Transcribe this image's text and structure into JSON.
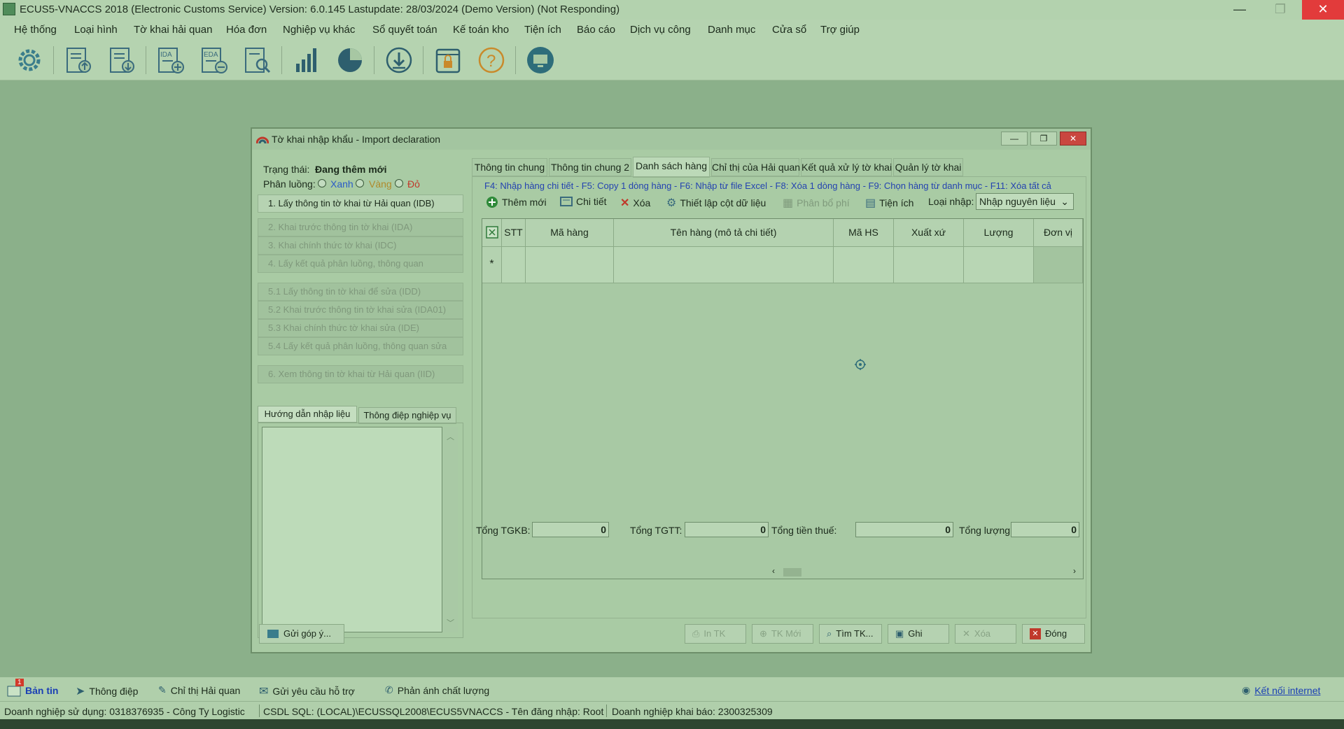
{
  "window": {
    "title": "ECUS5-VNACCS 2018 (Electronic Customs Service) Version: 6.0.145 Lastupdate: 28/03/2024 (Demo Version) (Not Responding)",
    "minimize": "—",
    "maximize": "❐",
    "close": "✕"
  },
  "menu": [
    "Hệ thống",
    "Loại hình",
    "Tờ khai hải quan",
    "Hóa đơn",
    "Nghiệp vụ khác",
    "Sổ quyết toán",
    "Kế toán kho",
    "Tiện ích",
    "Báo cáo",
    "Dịch vụ công",
    "Danh mục",
    "Cửa sổ",
    "Trợ giúp"
  ],
  "toolbar_icons": [
    "settings-gear-icon",
    "export-declaration-icon",
    "import-declaration-icon",
    "ida-add-icon",
    "eda-edit-icon",
    "search-document-icon",
    "bar-chart-icon",
    "pie-chart-icon",
    "download-icon",
    "lock-icon",
    "help-icon",
    "remote-support-icon"
  ],
  "toolbar_labels": {
    "ida": "IDA",
    "eda": "EDA",
    "help": "?"
  },
  "dialog": {
    "title": "Tờ khai nhập khẩu - Import declaration",
    "status_label": "Trạng thái:",
    "status_value": "Đang thêm mới",
    "channel_label": "Phân luồng:",
    "channels": [
      "Xanh",
      "Vàng",
      "Đỏ"
    ],
    "channel_colors": [
      "#2a5bc8",
      "#b08a2a",
      "#c0392b"
    ],
    "steps": [
      "1. Lấy thông tin tờ khai từ Hải quan (IDB)",
      "2. Khai trước thông tin tờ khai (IDA)",
      "3. Khai chính thức tờ khai (IDC)",
      "4. Lấy kết quả phân luồng, thông quan",
      "5.1 Lấy thông tin tờ khai để sửa (IDD)",
      "5.2 Khai trước thông tin tờ khai sửa (IDA01)",
      "5.3 Khai chính thức tờ khai sửa (IDE)",
      "5.4 Lấy kết quả phân luồng, thông quan sửa",
      "6. Xem thông tin tờ khai từ Hải quan (IID)"
    ],
    "subtabs": [
      "Hướng dẫn nhập liệu",
      "Thông điệp nghiệp vụ"
    ],
    "feedback_button": "Gửi góp ý...",
    "tabs": [
      "Thông tin chung",
      "Thông tin chung 2",
      "Danh sách hàng",
      "Chỉ thị của Hải quan",
      "Kết quả xử lý tờ khai",
      "Quản lý tờ khai"
    ],
    "hotkeys": "F4: Nhập hàng chi tiết - F5: Copy 1 dòng hàng - F6: Nhập từ file Excel - F8: Xóa 1 dòng hàng - F9: Chọn hàng từ danh mục - F11: Xóa tất cả",
    "actions": {
      "add": "Thêm mới",
      "detail": "Chi tiết",
      "delete": "Xóa",
      "columns": "Thiết lập cột dữ liệu",
      "allocate": "Phân bổ phí",
      "utility": "Tiện ích",
      "import_type_label": "Loại nhập:",
      "import_type_value": "Nhập nguyên liệu"
    },
    "grid": {
      "columns": [
        "STT",
        "Mã hàng",
        "Tên hàng (mô tả chi tiết)",
        "Mã HS",
        "Xuất xứ",
        "Lượng",
        "Đơn vị"
      ],
      "new_row_marker": "*"
    },
    "totals": {
      "tgkb_label": "Tổng TGKB:",
      "tgkb": "0",
      "tgtt_label": "Tổng TGTT:",
      "tgtt": "0",
      "tax_label": "Tổng tiền thuế:",
      "tax": "0",
      "qty_label": "Tổng lượng:",
      "qty": "0"
    },
    "buttons": {
      "print": "In TK",
      "new": "TK Mới",
      "find": "Tìm TK...",
      "save": "Ghi",
      "delete": "Xóa",
      "close": "Đóng"
    }
  },
  "bottom_bar": {
    "news": "Bản tin",
    "news_badge": "1",
    "messages": "Thông điệp",
    "customs_directive": "Chỉ thị Hải quan",
    "support_request": "Gửi yêu cầu hỗ trợ",
    "quality_feedback": "Phản ánh chất lượng",
    "internet": "Kết nối internet"
  },
  "status_bar": {
    "company": "Doanh nghiệp sử dụng: 0318376935 - Công Ty Logistic",
    "db": "CSDL SQL: (LOCAL)\\ECUSSQL2008\\ECUS5VNACCS - Tên đăng nhập: Root",
    "declarant": "Doanh nghiệp khai báo: 2300325309"
  }
}
